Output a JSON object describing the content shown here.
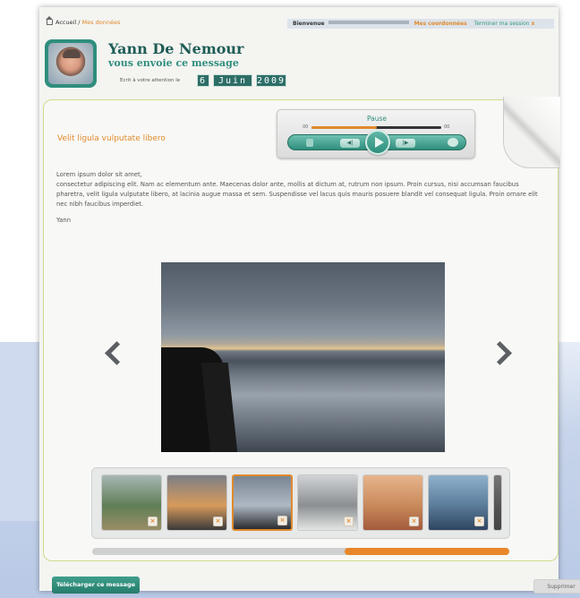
{
  "breadcrumb": {
    "home": "Accueil",
    "separator": " / ",
    "current": "Mes données"
  },
  "userbar": {
    "welcome": "Bienvenue",
    "contact": "Mes coordonnées",
    "logout": "Terminer ma session",
    "close": "x"
  },
  "sender": {
    "name": "Yann De Nemour",
    "subtitle": "vous envoie ce message"
  },
  "date": {
    "prefix": "Ecrit à votre attention le",
    "day": "6",
    "month": "Juin",
    "year": "2009"
  },
  "message": {
    "title": "Velit ligula vulputate libero",
    "greeting": "Lorem ipsum dolor sit amet,",
    "body": "consectetur adipiscing elit. Nam ac elementum ante. Maecenas dolor ante, mollis at dictum at, rutrum non ipsum. Proin cursus, nisi accumsan faucibus pharetra, velit ligula vulputate libero, at lacinia augue massa et sem. Suspendisse vel lacus quis mauris posuere blandit vel consequat ligula. Proin ornare elit nec nibh faucibus imperdiet.",
    "signature": "Yann"
  },
  "player": {
    "status": "Pause",
    "progress": 0.5,
    "time_start": "00",
    "time_end": "00"
  },
  "gallery": {
    "thumbnails": [
      {
        "colors": [
          "#a8b7b4",
          "#5f7f57",
          "#9a8d66"
        ],
        "selected": false
      },
      {
        "colors": [
          "#7b7f86",
          "#d79a5c",
          "#3a3a3a"
        ],
        "selected": false
      },
      {
        "colors": [
          "#7a8593",
          "#aeb8c3",
          "#2a2c2f"
        ],
        "selected": true
      },
      {
        "colors": [
          "#cfd3d6",
          "#8b8f91",
          "#e3e4e4"
        ],
        "selected": false
      },
      {
        "colors": [
          "#e6b48c",
          "#c98a5b",
          "#a55a3c"
        ],
        "selected": false
      },
      {
        "colors": [
          "#8fb1cc",
          "#5b7c9b",
          "#2f4560"
        ],
        "selected": false
      },
      {
        "colors": [
          "#777",
          "#555",
          "#444"
        ],
        "selected": false
      }
    ],
    "scroll_position": 0.61
  },
  "actions": {
    "download": "Télécharger ce message",
    "delete": "Supprimer"
  },
  "colors": {
    "accent": "#e08a2c",
    "brand": "#2f8e7d",
    "border": "#cddc8a"
  }
}
